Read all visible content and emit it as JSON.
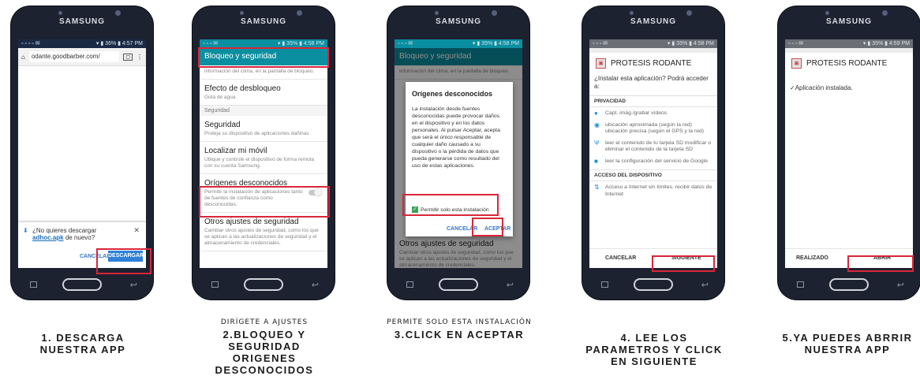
{
  "device_brand": "SAMSUNG",
  "steps": [
    {
      "status": {
        "left": "▫ ▫ ▫ ▫ ✉",
        "right": "▾ ▮ 36% ▮ 4:57 PM"
      },
      "url": "odante.goodbarber.com/",
      "download": {
        "question": "¿No quieres descargar",
        "file": "adhoc.apk",
        "suffix": "de nuevo?",
        "cancel": "CANCELAR",
        "confirm": "DESCARGAR"
      },
      "caption_small": "",
      "caption_lines": [
        "1. DESCARGA",
        "NUESTRA APP"
      ]
    },
    {
      "status": {
        "left": "▫ ▫ ▫ ✉",
        "right": "▾ ▮ 35% ▮ 4:58 PM"
      },
      "title": "Bloqueo y seguridad",
      "items": [
        {
          "title": "",
          "sub": "información del clima, en la pantalla de bloqueo."
        },
        {
          "title": "Efecto de desbloqueo",
          "sub": "Gota de agua"
        },
        {
          "title": "Seguridad",
          "sub": "Proteja su dispositivo de aplicaciones dañinas"
        },
        {
          "title": "Localizar mi móvil",
          "sub": "Ubique y controle el dispositivo de forma remota con su cuenta Samsung."
        },
        {
          "title": "Orígenes desconocidos",
          "sub": "Permitir la instalación de aplicaciones tanto de fuentes de confianza como desconocidas."
        },
        {
          "title": "Otros ajustes de seguridad",
          "sub": "Cambiar otros ajustes de seguridad, como los que se aplican a las actualizaciones de seguridad y el almacenamiento de credenciales."
        }
      ],
      "section": "Seguridad",
      "caption_small": "DIRÍGETE A AJUSTES",
      "caption_lines": [
        "2.BLOQUEO Y",
        "SEGURIDAD",
        "ORIGENES",
        "DESCONOCIDOS"
      ]
    },
    {
      "status": {
        "left": "▫ ▫ ▫ ✉",
        "right": "▾ ▮ 35% ▮ 4:58 PM"
      },
      "title": "Bloqueo y seguridad",
      "bg_text": "Información del clima, en la pantalla de bloqueo.",
      "bg_bottom_title": "Otros ajustes de seguridad",
      "bg_bottom_sub": "Cambiar otros ajustes de seguridad, como los que se aplican a las actualizaciones de seguridad y el almacenamiento de credenciales.",
      "dialog": {
        "title": "Orígenes desconocidos",
        "body": "La instalación desde fuentes desconocidas puede provocar daños en el dispositivo y en los datos personales. Al pulsar Aceptar, acepta que será el único responsable de cualquier daño causado a su dispositivo o la pérdida de datos que pueda generarse como resultado del uso de estas aplicaciones.",
        "check": "Permitir solo esta instalación",
        "cancel": "CANCELAR",
        "accept": "ACEPTAR"
      },
      "caption_small": "PERMITE SOLO ESTA INSTALACIÓN",
      "caption_lines": [
        "3.CLICK EN ACEPTAR"
      ]
    },
    {
      "status": {
        "left": "▫ ▫ ▫ ✉",
        "right": "▾ ▮ 35% ▮ 4:58 PM"
      },
      "app_name": "PROTESIS RODANTE",
      "question": "¿Instalar esta aplicación? Podrá acceder a:",
      "privacy_header": "PRIVACIDAD",
      "perms": [
        "Capt. imág./grabar vídeos",
        "ubicación aproximada (según la red) ubicación precisa (según el GPS y la red)",
        "leer el contenido de tu tarjeta SD modificar o eliminar el contenido de la tarjeta SD",
        "leer la configuración del servicio de Google"
      ],
      "access_header": "ACCESO DEL DISPOSITIVO",
      "access_perm": "Acceso a Internet sin límites. recibir datos de Internet",
      "cancel": "CANCELAR",
      "next": "SIGUIENTE",
      "caption_small": "",
      "caption_lines": [
        "4. LEE LOS",
        "PARAMETROS Y CLICK",
        "EN SIGUIENTE"
      ]
    },
    {
      "status": {
        "left": "▫ ▫ ▫ ✉",
        "right": "▾ ▮ 35% ▮ 4:59 PM"
      },
      "app_name": "PROTESIS RODANTE",
      "installed": "✓Aplicación instalada.",
      "done": "REALIZADO",
      "open": "ABRIR",
      "caption_small": "",
      "caption_lines": [
        "5.YA PUEDES ABRRIR",
        "NUESTRA APP"
      ]
    }
  ]
}
